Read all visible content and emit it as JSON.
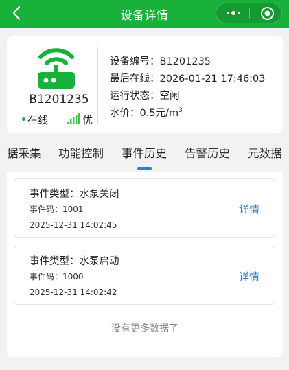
{
  "header": {
    "title": "设备详情",
    "back_icon": "chevron-left-icon",
    "more_icon": "more-dots-icon",
    "close_icon": "target-circle-icon",
    "color": "#18b13a"
  },
  "device": {
    "name": "B1201235",
    "status": "在线",
    "signal_quality": "优",
    "icon": "router-wifi-icon",
    "info": {
      "id_label": "设备编号：",
      "id_value": "B1201235",
      "last_online_label": "最后在线：",
      "last_online_value": "2026-01-21 17:46:03",
      "run_status_label": "运行状态：",
      "run_status_value": "空闲",
      "price_label": "水价：",
      "price_value": "0.5元/m",
      "price_unit_sup": "3"
    }
  },
  "tabs": [
    {
      "label": "据采集"
    },
    {
      "label": "功能控制"
    },
    {
      "label": "事件历史",
      "active": true
    },
    {
      "label": "告警历史"
    },
    {
      "label": "元数据"
    }
  ],
  "events": [
    {
      "type_label": "事件类型：",
      "type_value": "水泵关闭",
      "code_label": "事件码：",
      "code_value": "1001",
      "time": "2025-12-31 14:02:45",
      "detail_label": "详情"
    },
    {
      "type_label": "事件类型：",
      "type_value": "水泵启动",
      "code_label": "事件码：",
      "code_value": "1000",
      "time": "2025-12-31 14:02:42",
      "detail_label": "详情"
    }
  ],
  "footer": {
    "no_more": "没有更多数据了"
  },
  "colors": {
    "accent": "#18b13a",
    "link": "#2f7fd3"
  }
}
